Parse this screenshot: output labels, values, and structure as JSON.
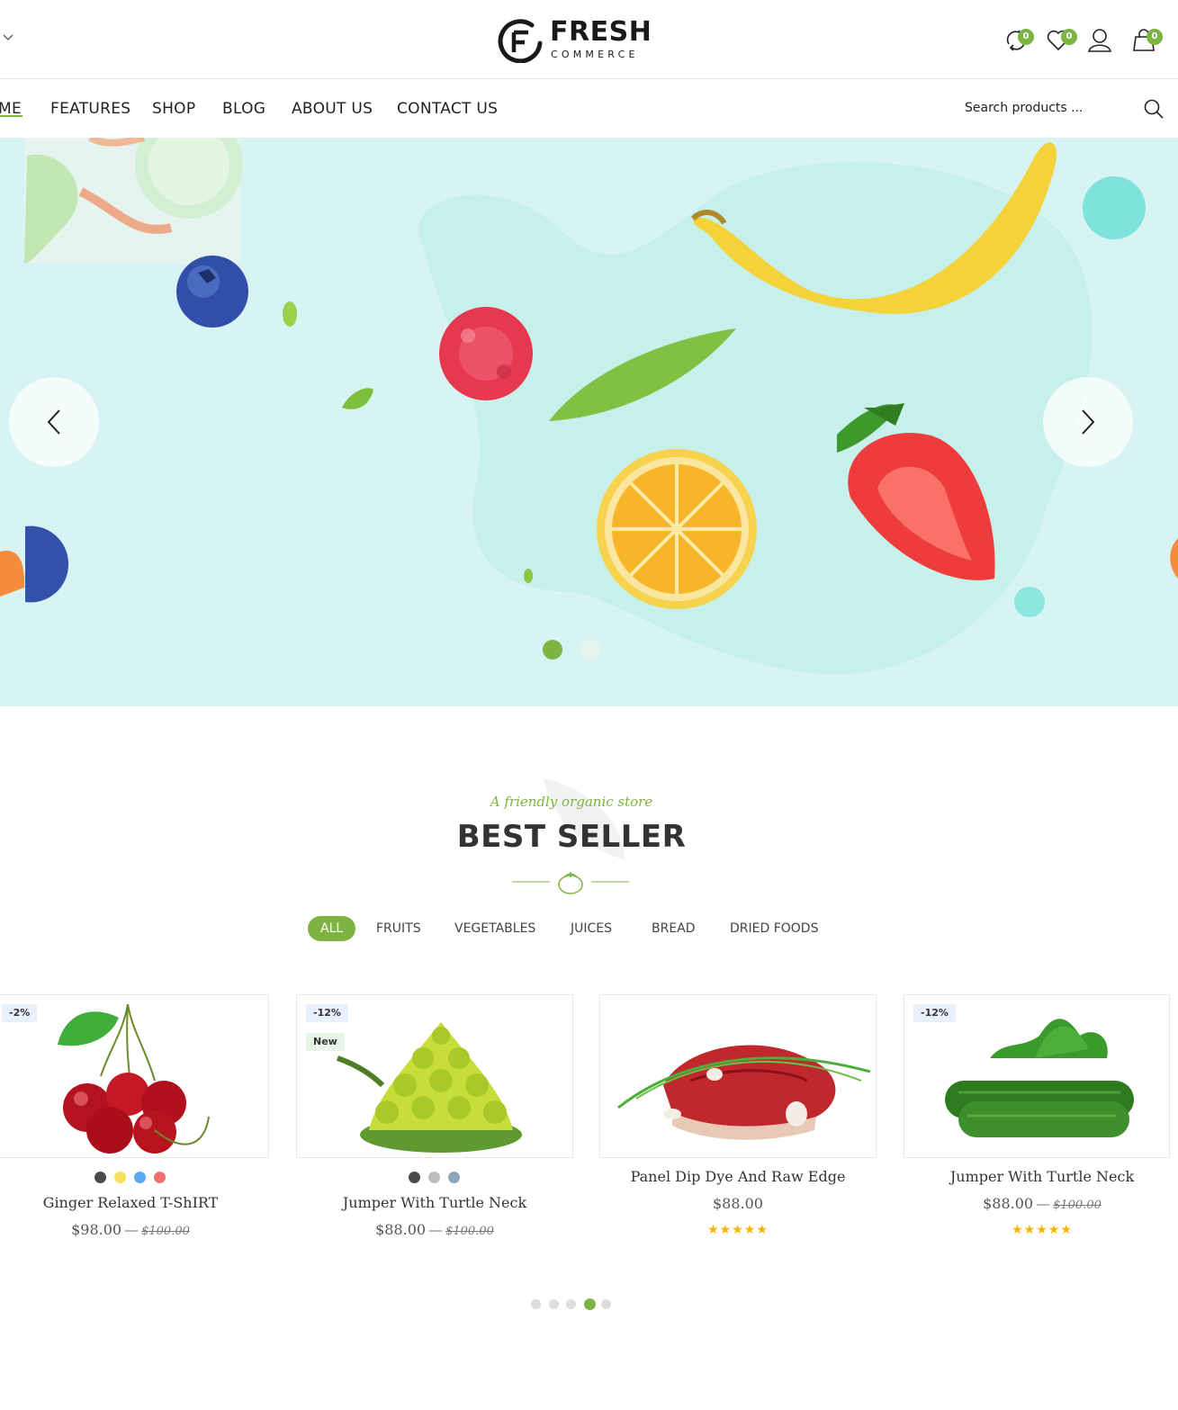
{
  "brand": {
    "logo_main": "FRESH",
    "logo_sub": "COMMERCE",
    "accent_color": "#7cb342"
  },
  "header": {
    "icons": [
      {
        "name": "compare-icon",
        "badge": "0"
      },
      {
        "name": "wishlist-heart-icon",
        "badge": "0"
      },
      {
        "name": "user-account-icon",
        "badge": ""
      },
      {
        "name": "cart-bag-icon",
        "badge": "0"
      }
    ]
  },
  "nav": {
    "items": [
      "ME",
      "FEATURES",
      "SHOP",
      "BLOG",
      "ABOUT US",
      "CONTACT US"
    ],
    "active_index": 0,
    "search_placeholder": "Search products ..."
  },
  "hero": {
    "slide_count": 2,
    "active_slide": 0
  },
  "best_seller": {
    "subtitle": "A friendly organic store",
    "title": "BEST SELLER",
    "filters": [
      "ALL",
      "FRUITS",
      "VEGETABLES",
      "JUICES",
      "BREAD",
      "DRIED FOODS"
    ],
    "active_filter": 0
  },
  "products": [
    {
      "name": "Ginger Relaxed T-ShIRT",
      "price": "$98.00",
      "old_price": "$100.00",
      "badges": [
        "-2%"
      ],
      "swatches": [
        "#4a4a4a",
        "#f7e15a",
        "#5aa9f0",
        "#f07070"
      ],
      "rating": 0
    },
    {
      "name": "Jumper With Turtle Neck",
      "price": "$88.00",
      "old_price": "$100.00",
      "badges": [
        "-12%",
        "New"
      ],
      "swatches": [
        "#4a4a4a",
        "#bdbdbd",
        "#8fa6ba"
      ],
      "rating": 0
    },
    {
      "name": "Panel Dip Dye And Raw Edge",
      "price": "$88.00",
      "old_price": "",
      "badges": [],
      "swatches": [],
      "rating": 5
    },
    {
      "name": "Jumper With Turtle Neck",
      "price": "$88.00",
      "old_price": "$100.00",
      "badges": [
        "-12%"
      ],
      "swatches": [],
      "rating": 5
    }
  ],
  "products_pager": {
    "count": 5,
    "active": 3
  },
  "price_separator": "—"
}
